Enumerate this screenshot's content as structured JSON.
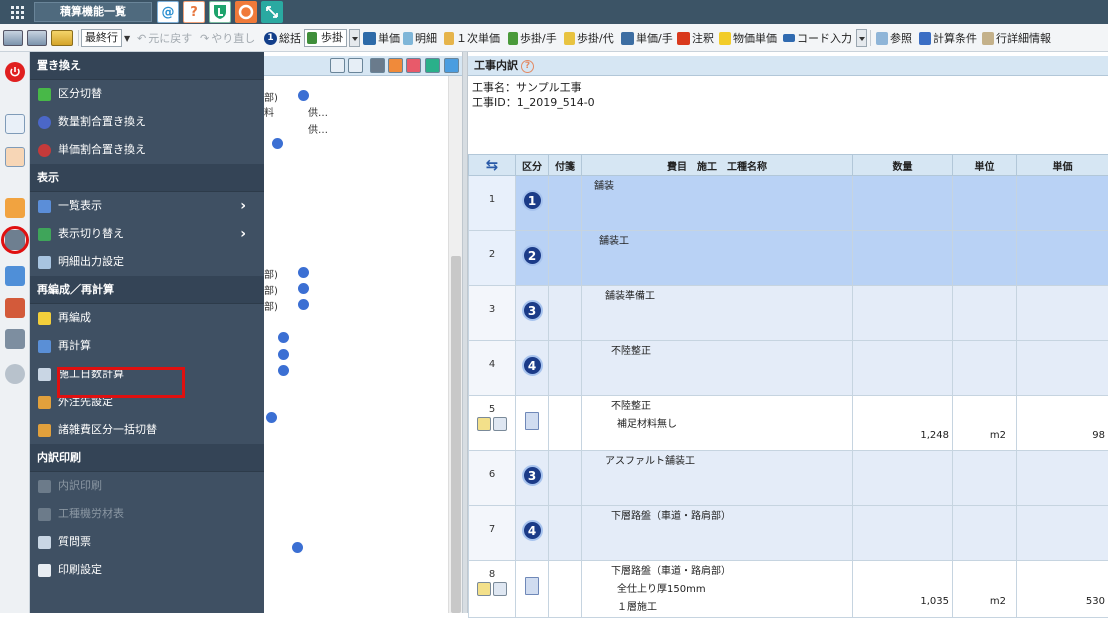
{
  "app": {
    "title": "積算機能一覧"
  },
  "toolbar": {
    "mode_select": "最終行",
    "undo": "元に戻す",
    "redo": "やり直し",
    "sokatsu": "総括",
    "bugake": "歩掛",
    "tanka": "単価",
    "meisai": "明細",
    "ichiji_tanka": "１次単価",
    "bugake_te": "歩掛/手",
    "bugake_dai": "歩掛/代",
    "tanka_te": "単価/手",
    "chuki": "注釈",
    "bukken_tanka": "物価単価",
    "code_input": "コード入力",
    "sansho": "参照",
    "keisan_joken": "計算条件",
    "gyo_shosai": "行詳細情報"
  },
  "side_menu": {
    "sections": [
      {
        "title": "置き換え",
        "items": [
          {
            "label": "区分切替",
            "disabled": false,
            "chevron": false
          },
          {
            "label": "数量割合置き換え",
            "disabled": false,
            "chevron": false
          },
          {
            "label": "単価割合置き換え",
            "disabled": false,
            "chevron": false
          }
        ]
      },
      {
        "title": "表示",
        "items": [
          {
            "label": "一覧表示",
            "disabled": false,
            "chevron": true
          },
          {
            "label": "表示切り替え",
            "disabled": false,
            "chevron": true
          },
          {
            "label": "明細出力設定",
            "disabled": false,
            "chevron": false
          }
        ]
      },
      {
        "title": "再編成／再計算",
        "items": [
          {
            "label": "再編成",
            "disabled": false,
            "chevron": false
          },
          {
            "label": "再計算",
            "disabled": false,
            "chevron": false
          },
          {
            "label": "施工日数計算",
            "disabled": false,
            "chevron": false
          },
          {
            "label": "外注先設定",
            "disabled": false,
            "chevron": false
          },
          {
            "label": "諸雑費区分一括切替",
            "disabled": false,
            "chevron": false
          }
        ]
      },
      {
        "title": "内訳印刷",
        "items": [
          {
            "label": "内訳印刷",
            "disabled": true,
            "chevron": false
          },
          {
            "label": "工種機労材表",
            "disabled": true,
            "chevron": false
          },
          {
            "label": "質問票",
            "disabled": false,
            "chevron": false
          },
          {
            "label": "印刷設定",
            "disabled": false,
            "chevron": false
          }
        ]
      }
    ]
  },
  "tree": {
    "fragments": [
      "部)",
      "料",
      "供…",
      "供…",
      "部)",
      "部)",
      "部)"
    ]
  },
  "right_panel": {
    "title": "工事内訳",
    "project_name": "工事名：サンプル工事",
    "project_id": "工事ID：1_2019_514-0"
  },
  "table": {
    "headers": {
      "kubun": "区分",
      "fusen": "付箋",
      "himoku": "費目　施工　工種名称",
      "suryo": "数量",
      "tani": "単位",
      "tanka": "単価"
    },
    "rows": [
      {
        "no": "1",
        "level": "1",
        "lines": [
          "舗装"
        ],
        "qty": "",
        "unit": "",
        "price": "",
        "style": "blue",
        "indent": 1
      },
      {
        "no": "2",
        "level": "2",
        "lines": [
          "舗装工"
        ],
        "qty": "",
        "unit": "",
        "price": "",
        "style": "blue",
        "indent": 2
      },
      {
        "no": "3",
        "level": "3",
        "lines": [
          "舗装準備工"
        ],
        "qty": "",
        "unit": "",
        "price": "",
        "style": "light",
        "indent": 3
      },
      {
        "no": "4",
        "level": "4",
        "lines": [
          "不陸整正"
        ],
        "qty": "",
        "unit": "",
        "price": "",
        "style": "light",
        "indent": 4
      },
      {
        "no": "5",
        "level": "",
        "lines": [
          "不陸整正",
          "補足材料無し"
        ],
        "qty": "1,248",
        "unit": "m2",
        "price": "98",
        "style": "white",
        "indent": 4
      },
      {
        "no": "6",
        "level": "3",
        "lines": [
          "アスファルト舗装工"
        ],
        "qty": "",
        "unit": "",
        "price": "",
        "style": "light",
        "indent": 3
      },
      {
        "no": "7",
        "level": "4",
        "lines": [
          "下層路盤（車道・路肩部）"
        ],
        "qty": "",
        "unit": "",
        "price": "",
        "style": "light",
        "indent": 4
      },
      {
        "no": "8",
        "level": "",
        "lines": [
          "下層路盤（車道・路肩部）",
          "全仕上り厚150mm",
          "１層施工"
        ],
        "qty": "1,035",
        "unit": "m2",
        "price": "530",
        "style": "white",
        "indent": 4
      }
    ]
  }
}
